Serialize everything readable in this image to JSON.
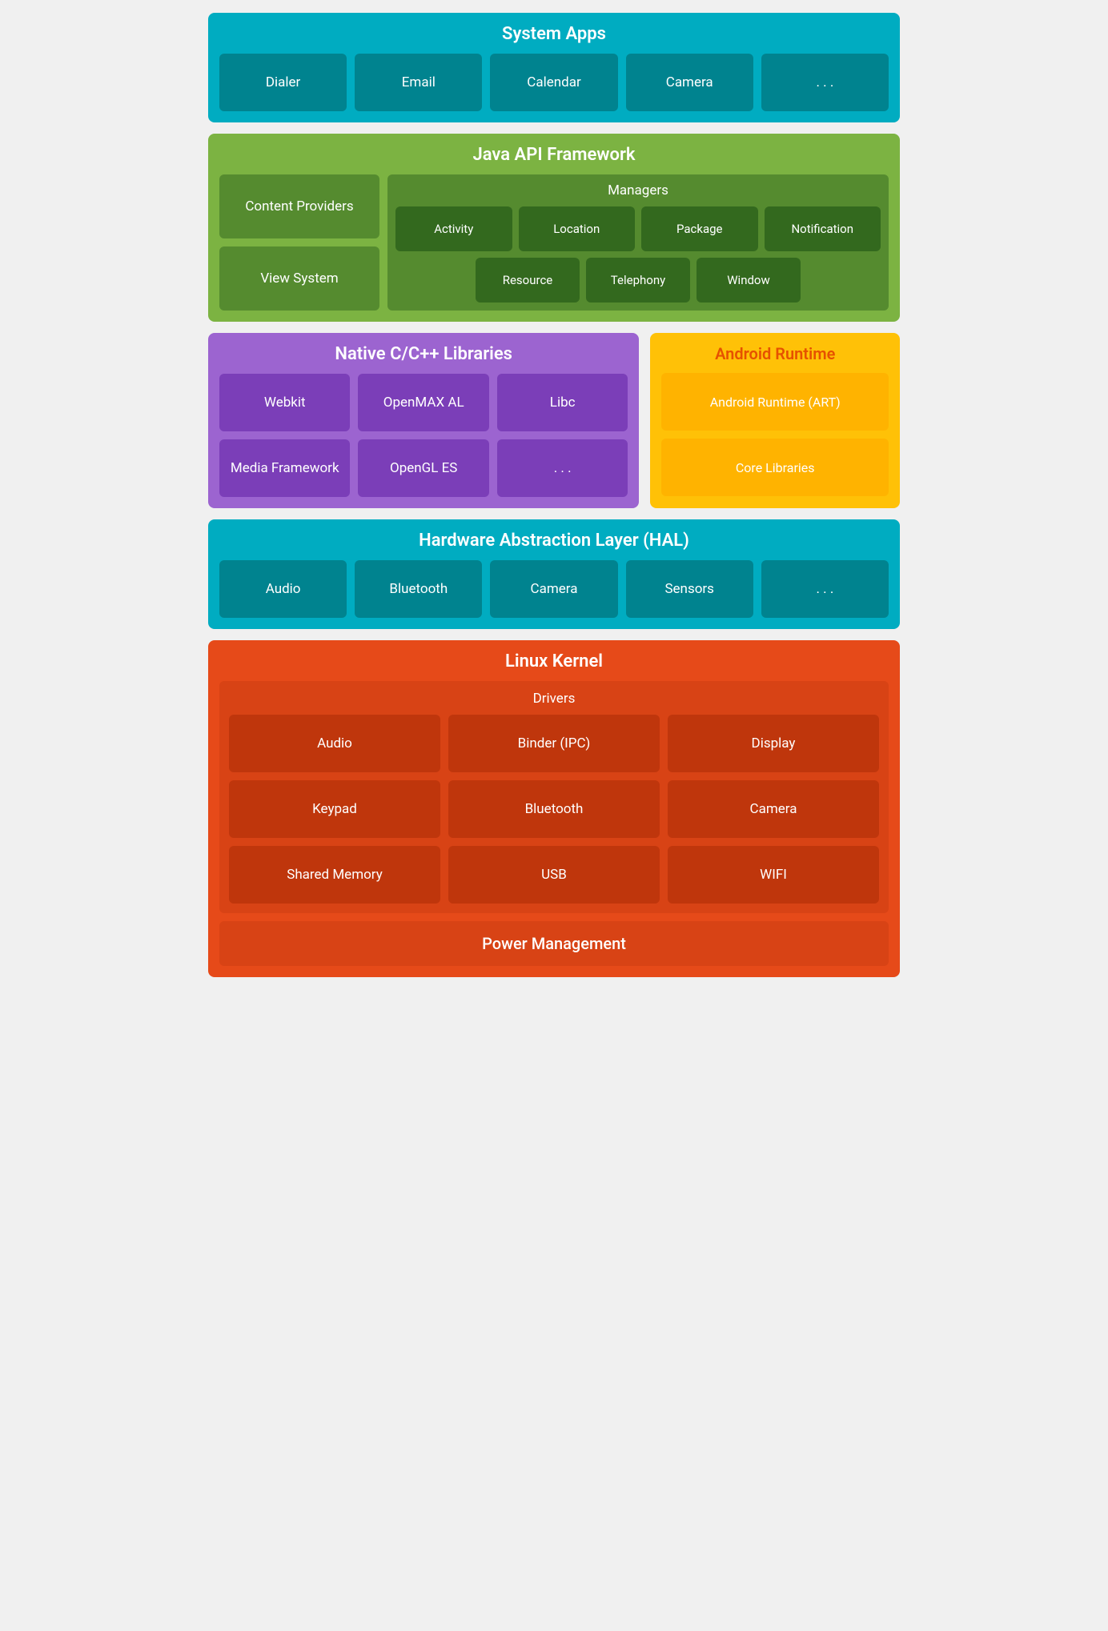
{
  "system_apps": {
    "title": "System Apps",
    "tiles": [
      "Dialer",
      "Email",
      "Calendar",
      "Camera",
      ". . ."
    ]
  },
  "java_api": {
    "title": "Java API Framework",
    "left_tiles": [
      "Content Providers",
      "View System"
    ],
    "managers_title": "Managers",
    "managers_row1": [
      "Activity",
      "Location",
      "Package",
      "Notification"
    ],
    "managers_row2": [
      "Resource",
      "Telephony",
      "Window"
    ]
  },
  "native": {
    "title": "Native C/C++ Libraries",
    "tiles": [
      "Webkit",
      "OpenMAX AL",
      "Libc",
      "Media Framework",
      "OpenGL ES",
      ". . ."
    ]
  },
  "runtime": {
    "title": "Android Runtime",
    "tiles": [
      "Android Runtime (ART)",
      "Core Libraries"
    ]
  },
  "hal": {
    "title": "Hardware Abstraction Layer (HAL)",
    "tiles": [
      "Audio",
      "Bluetooth",
      "Camera",
      "Sensors",
      ". . ."
    ]
  },
  "kernel": {
    "title": "Linux Kernel",
    "drivers_title": "Drivers",
    "drivers": [
      "Audio",
      "Binder (IPC)",
      "Display",
      "Keypad",
      "Bluetooth",
      "Camera",
      "Shared Memory",
      "USB",
      "WIFI"
    ],
    "power_management": "Power Management"
  }
}
